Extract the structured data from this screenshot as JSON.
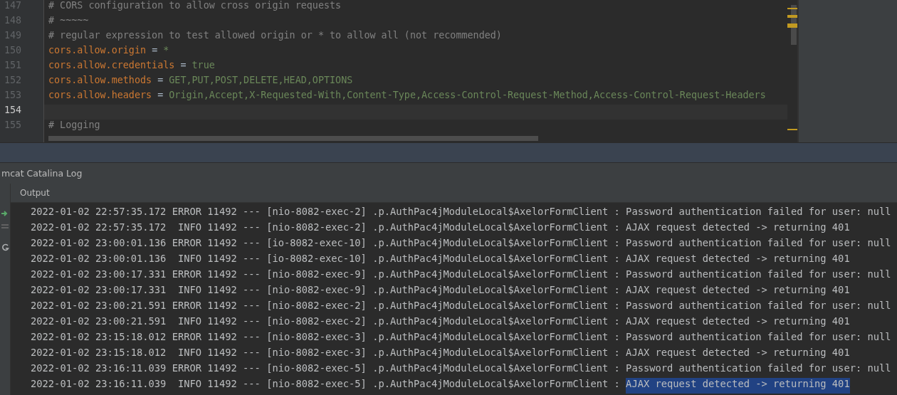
{
  "editor": {
    "lines": [
      {
        "number": "147",
        "kind": "comment",
        "text": "# CORS configuration to allow cross origin requests",
        "current": false
      },
      {
        "number": "148",
        "kind": "comment",
        "text": "# ~~~~~",
        "current": false
      },
      {
        "number": "149",
        "kind": "comment",
        "text": "# regular expression to test allowed origin or * to allow all (not recommended)",
        "current": false
      },
      {
        "number": "150",
        "kind": "property",
        "key": "cors.allow.origin",
        "separator": "=",
        "value": "*",
        "current": false
      },
      {
        "number": "151",
        "kind": "property",
        "key": "cors.allow.credentials",
        "separator": "=",
        "value": "true",
        "current": false
      },
      {
        "number": "152",
        "kind": "property",
        "key": "cors.allow.methods",
        "separator": "=",
        "value": "GET,PUT,POST,DELETE,HEAD,OPTIONS",
        "current": false
      },
      {
        "number": "153",
        "kind": "property",
        "key": "cors.allow.headers",
        "separator": "=",
        "value": "Origin,Accept,X-Requested-With,Content-Type,Access-Control-Request-Method,Access-Control-Request-Headers",
        "current": false
      },
      {
        "number": "154",
        "kind": "blank",
        "current": true
      },
      {
        "number": "155",
        "kind": "comment",
        "text": "# Logging",
        "current": false
      }
    ]
  },
  "tool_window": {
    "title": "mcat Catalina Log",
    "tabs": [
      {
        "label": "Output",
        "selected": true
      }
    ],
    "log": [
      {
        "prefix": "2022-01-02 22:57:35.172 ERROR 11492 --- [nio-8082-exec-2] .p.AuthPac4jModuleLocal$AxelorFormClient : ",
        "message": "Password authentication failed for user: null",
        "selected": false
      },
      {
        "prefix": "2022-01-02 22:57:35.172  INFO 11492 --- [nio-8082-exec-2] .p.AuthPac4jModuleLocal$AxelorFormClient : ",
        "message": "AJAX request detected -> returning 401",
        "selected": false
      },
      {
        "prefix": "2022-01-02 23:00:01.136 ERROR 11492 --- [io-8082-exec-10] .p.AuthPac4jModuleLocal$AxelorFormClient : ",
        "message": "Password authentication failed for user: null",
        "selected": false
      },
      {
        "prefix": "2022-01-02 23:00:01.136  INFO 11492 --- [io-8082-exec-10] .p.AuthPac4jModuleLocal$AxelorFormClient : ",
        "message": "AJAX request detected -> returning 401",
        "selected": false
      },
      {
        "prefix": "2022-01-02 23:00:17.331 ERROR 11492 --- [nio-8082-exec-9] .p.AuthPac4jModuleLocal$AxelorFormClient : ",
        "message": "Password authentication failed for user: null",
        "selected": false
      },
      {
        "prefix": "2022-01-02 23:00:17.331  INFO 11492 --- [nio-8082-exec-9] .p.AuthPac4jModuleLocal$AxelorFormClient : ",
        "message": "AJAX request detected -> returning 401",
        "selected": false
      },
      {
        "prefix": "2022-01-02 23:00:21.591 ERROR 11492 --- [nio-8082-exec-2] .p.AuthPac4jModuleLocal$AxelorFormClient : ",
        "message": "Password authentication failed for user: null",
        "selected": false
      },
      {
        "prefix": "2022-01-02 23:00:21.591  INFO 11492 --- [nio-8082-exec-2] .p.AuthPac4jModuleLocal$AxelorFormClient : ",
        "message": "AJAX request detected -> returning 401",
        "selected": false
      },
      {
        "prefix": "2022-01-02 23:15:18.012 ERROR 11492 --- [nio-8082-exec-3] .p.AuthPac4jModuleLocal$AxelorFormClient : ",
        "message": "Password authentication failed for user: null",
        "selected": false
      },
      {
        "prefix": "2022-01-02 23:15:18.012  INFO 11492 --- [nio-8082-exec-3] .p.AuthPac4jModuleLocal$AxelorFormClient : ",
        "message": "AJAX request detected -> returning 401",
        "selected": false
      },
      {
        "prefix": "2022-01-02 23:16:11.039 ERROR 11492 --- [nio-8082-exec-5] .p.AuthPac4jModuleLocal$AxelorFormClient : ",
        "message": "Password authentication failed for user: null",
        "selected": false
      },
      {
        "prefix": "2022-01-02 23:16:11.039  INFO 11492 --- [nio-8082-exec-5] .p.AuthPac4jModuleLocal$AxelorFormClient : ",
        "message": "AJAX request detected -> returning 401",
        "selected": true
      }
    ]
  }
}
